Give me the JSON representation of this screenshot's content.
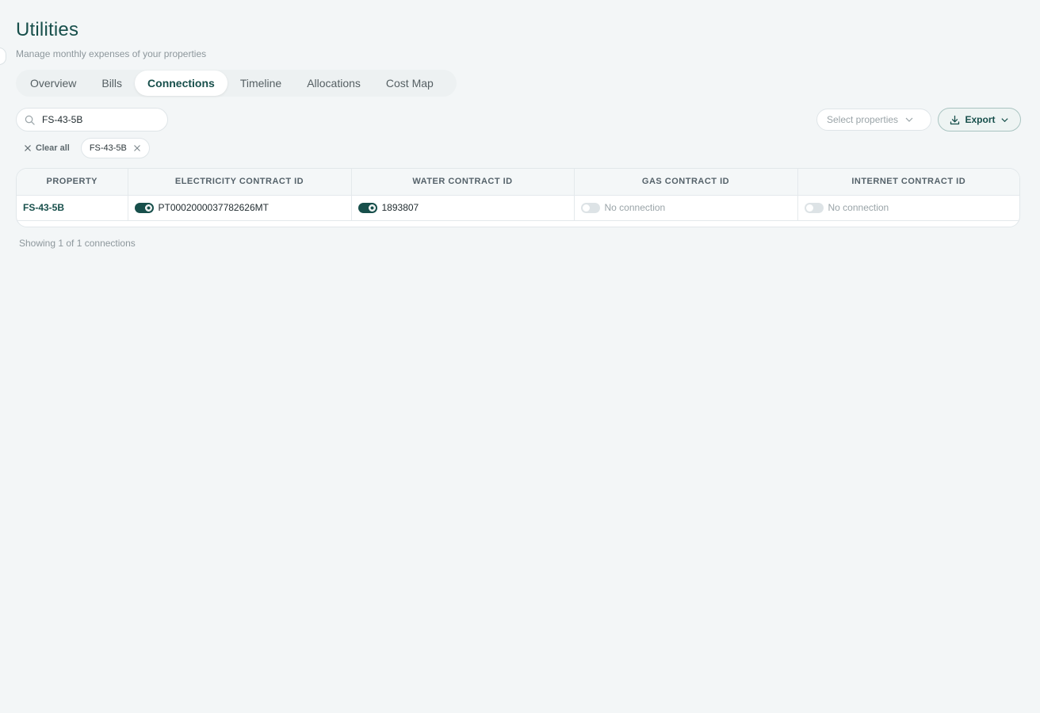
{
  "header": {
    "title": "Utilities",
    "subtitle": "Manage monthly expenses of your properties"
  },
  "tabs": [
    {
      "label": "Overview",
      "active": false
    },
    {
      "label": "Bills",
      "active": false
    },
    {
      "label": "Connections",
      "active": true
    },
    {
      "label": "Timeline",
      "active": false
    },
    {
      "label": "Allocations",
      "active": false
    },
    {
      "label": "Cost Map",
      "active": false
    }
  ],
  "search": {
    "value": "FS-43-5B",
    "icon": "search-icon"
  },
  "select_properties": {
    "placeholder": "Select properties",
    "icon": "chevron-down-icon"
  },
  "export": {
    "label": "Export",
    "icon": "download-icon"
  },
  "filters": {
    "clear_all_label": "Clear all",
    "chips": [
      {
        "label": "FS-43-5B"
      }
    ]
  },
  "table": {
    "columns": [
      "Property",
      "Electricity Contract ID",
      "Water Contract ID",
      "Gas Contract ID",
      "Internet Contract ID"
    ],
    "rows": [
      {
        "property": "FS-43-5B",
        "electricity": {
          "connected": true,
          "value": "PT0002000037782626MT"
        },
        "water": {
          "connected": true,
          "value": "1893807"
        },
        "gas": {
          "connected": false,
          "value": "No connection"
        },
        "internet": {
          "connected": false,
          "value": "No connection"
        }
      }
    ]
  },
  "footer": {
    "count_text": "Showing 1 of 1 connections"
  },
  "colors": {
    "accent": "#174f4b",
    "background": "#f3f6f7",
    "toggle_off": "#dde3e6"
  }
}
